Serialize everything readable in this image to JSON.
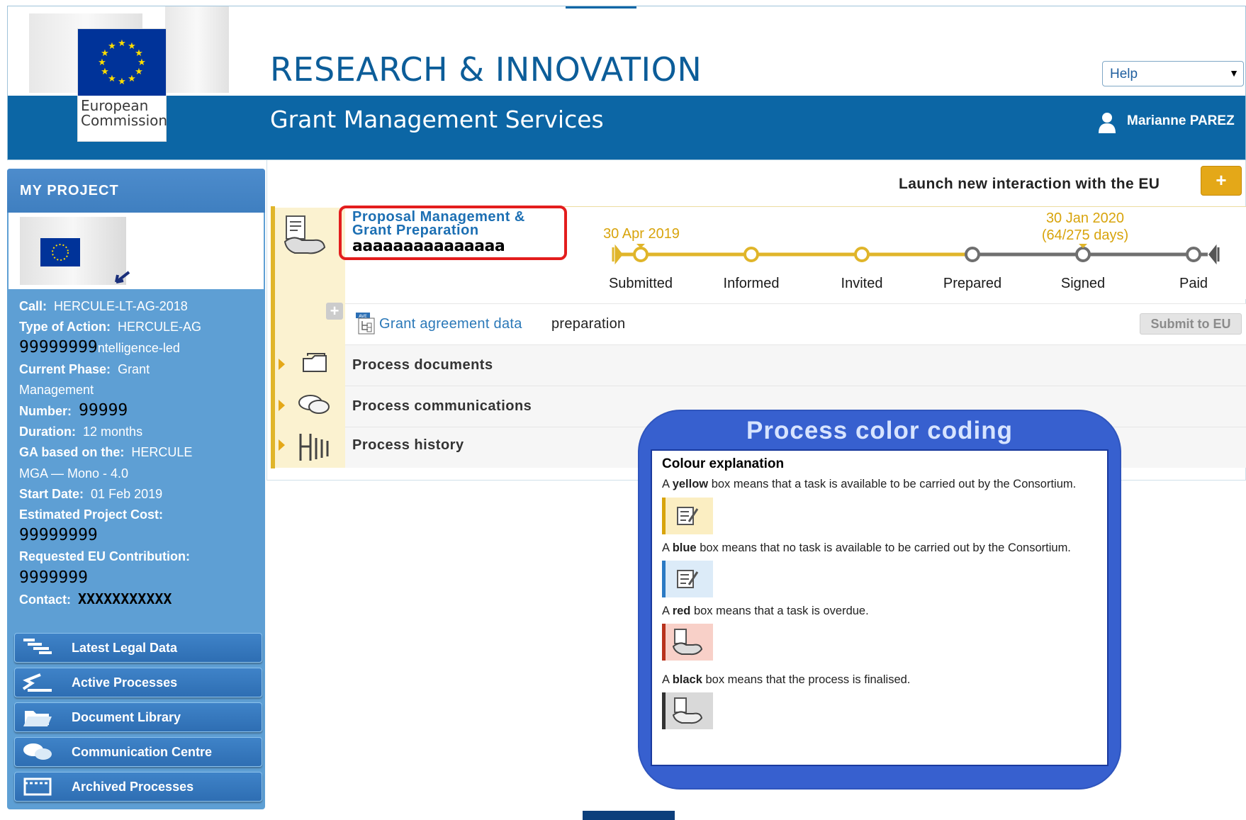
{
  "header": {
    "org_name": "European Commission",
    "title": "RESEARCH & INNOVATION",
    "subtitle": "Grant Management Services",
    "help_select": {
      "selected": "Help"
    },
    "user_name": "Marianne PAREZ"
  },
  "sidebar": {
    "title": "MY PROJECT",
    "info": {
      "call_label": "Call:",
      "call_value": "HERCULE-LT-AG-2018",
      "action_label": "Type of Action:",
      "action_value": "HERCULE-AG",
      "masked_mask": "99999999",
      "masked_tail": "ntelligence-led",
      "phase_label": "Current Phase:",
      "phase_value": "Grant",
      "phase_value2": "Management",
      "number_label": "Number:",
      "number_value": "99999",
      "duration_label": "Duration:",
      "duration_value": "12 months",
      "ga_label": "GA based on the:",
      "ga_value": "HERCULE",
      "ga_value2": "MGA — Mono - 4.0",
      "start_label": "Start Date:",
      "start_value": "01 Feb 2019",
      "cost_label": "Estimated Project Cost:",
      "cost_value": "99999999",
      "contrib_label": "Requested EU Contribution:",
      "contrib_value": "9999999",
      "contact_label": "Contact:",
      "contact_value": "XXXXXXXXXXX"
    },
    "nav": [
      {
        "label": "Latest Legal Data",
        "icon": "legal-data-icon"
      },
      {
        "label": "Active Processes",
        "icon": "active-processes-icon"
      },
      {
        "label": "Document Library",
        "icon": "folder-icon"
      },
      {
        "label": "Communication Centre",
        "icon": "chat-icon"
      },
      {
        "label": "Archived Processes",
        "icon": "archive-icon"
      }
    ]
  },
  "main": {
    "launch_text": "Launch new interaction with the EU",
    "launch_button": "+",
    "process": {
      "title": "Proposal Management & Grant Preparation",
      "masked_label": "aaaaaaaaaaaaaaa",
      "current_date": "30 Apr 2019",
      "target_date": "30 Jan 2020",
      "target_days": "(64/275 days)",
      "stages": [
        "Submitted",
        "Informed",
        "Invited",
        "Prepared",
        "Signed",
        "Paid"
      ],
      "completed_stage_count": 3,
      "ga_link": "Grant agreement data",
      "ga_status": "preparation",
      "submit_button": "Submit to EU",
      "rows": [
        "Process documents",
        "Process communications",
        "Process history"
      ]
    }
  },
  "legend": {
    "title": "Process color coding",
    "heading": "Colour explanation",
    "items": [
      {
        "prefix": "A ",
        "color_word": "yellow",
        "text": " box means that a task is available to be carried out by the Consortium.",
        "swatch_bg": "#fbeec2",
        "edge": "#d8a40c"
      },
      {
        "prefix": "A ",
        "color_word": "blue",
        "text": " box means that no task is available to be carried out by the Consortium.",
        "swatch_bg": "#dcebf8",
        "edge": "#2b7ac4"
      },
      {
        "prefix": "A ",
        "color_word": "red",
        "text": " box means that a task is overdue.",
        "swatch_bg": "#f8d0c8",
        "edge": "#b8321c"
      },
      {
        "prefix": "A ",
        "color_word": "black",
        "text": " box means that the process is finalised.",
        "swatch_bg": "#d9d9d9",
        "edge": "#333333"
      }
    ]
  },
  "colors": {
    "header_band": "#0c66a5",
    "sidebar": "#5e9fd4",
    "accent_gold": "#e0b52a",
    "legend_blue": "#3760cf",
    "highlight_red": "#e31d1d"
  }
}
